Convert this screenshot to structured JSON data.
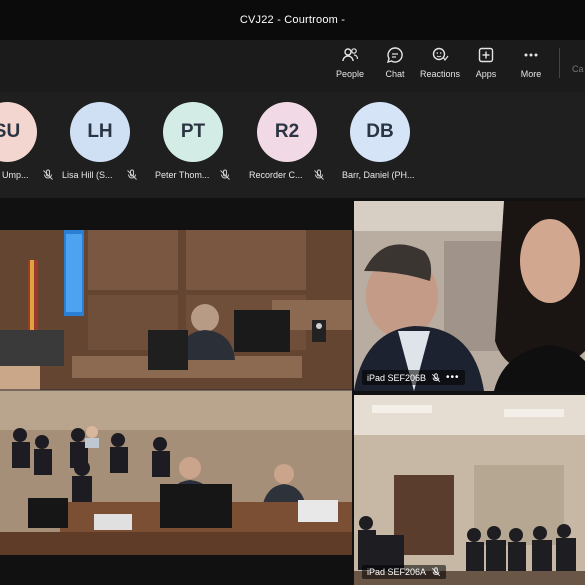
{
  "window": {
    "title": "CVJ22 - Courtroom -"
  },
  "toolbar": {
    "people": "People",
    "chat": "Chat",
    "reactions": "Reactions",
    "apps": "Apps",
    "more": "More",
    "camera_partial": "Ca"
  },
  "participants": [
    {
      "initials": "SU",
      "name": "Ump...",
      "color": "#f3d6d0"
    },
    {
      "initials": "LH",
      "name": "Lisa Hill (S...",
      "color": "#cfe0f5"
    },
    {
      "initials": "PT",
      "name": "Peter Thom...",
      "color": "#d4ece6"
    },
    {
      "initials": "R2",
      "name": "Recorder C...",
      "color": "#f2d9e6"
    },
    {
      "initials": "DB",
      "name": "Barr, Daniel (PH...",
      "color": "#d6e4f7"
    }
  ],
  "videos": {
    "top_right_label": "iPad SEF206B",
    "bottom_right_label": "iPad SEF206A",
    "more_dots": "•••"
  }
}
